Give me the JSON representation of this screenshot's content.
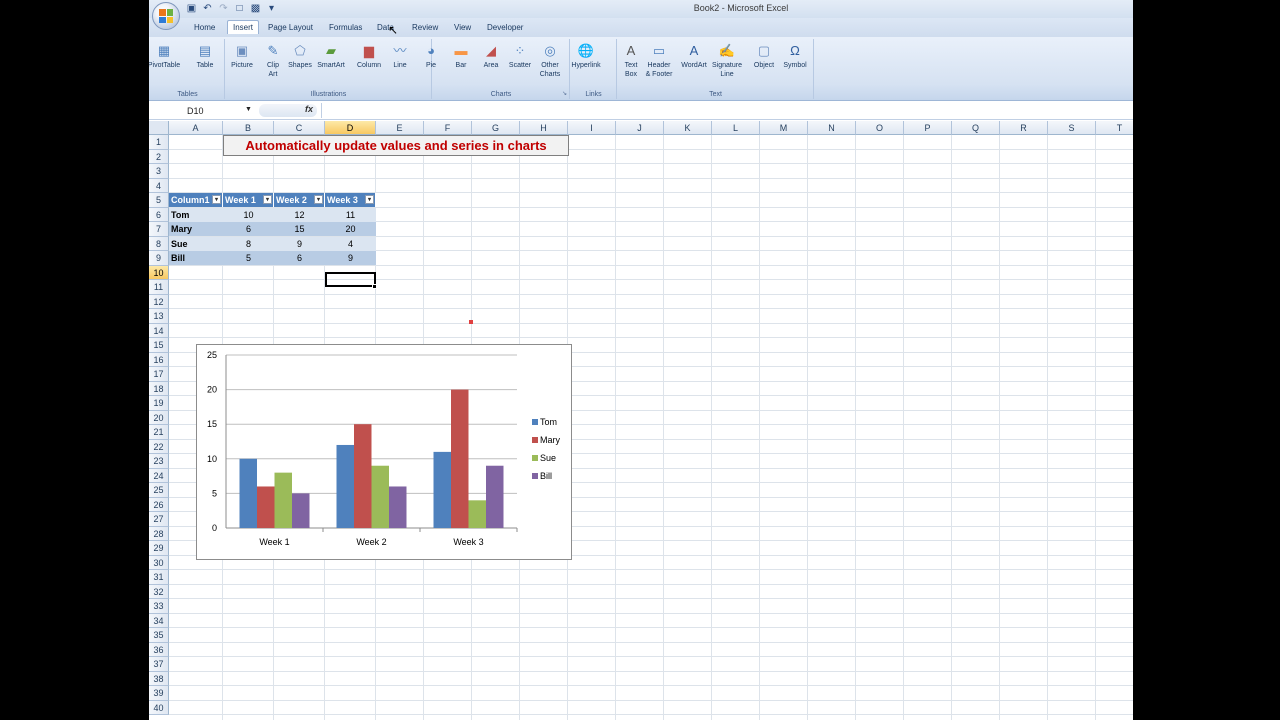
{
  "window": {
    "title": "Book2 - Microsoft Excel"
  },
  "tabs": [
    "Home",
    "Insert",
    "Page Layout",
    "Formulas",
    "Data",
    "Review",
    "View",
    "Developer"
  ],
  "ribbon": {
    "tables": {
      "label": "Tables",
      "items": [
        "PivotTable",
        "Table"
      ]
    },
    "illustrations": {
      "label": "Illustrations",
      "items": [
        "Picture",
        "Clip\nArt",
        "Shapes",
        "SmartArt"
      ]
    },
    "charts": {
      "label": "Charts",
      "items": [
        "Column",
        "Line",
        "Pie",
        "Bar",
        "Area",
        "Scatter",
        "Other\nCharts"
      ]
    },
    "links": {
      "label": "Links",
      "items": [
        "Hyperlink"
      ]
    },
    "text": {
      "label": "Text",
      "items": [
        "Text\nBox",
        "Header\n& Footer",
        "WordArt",
        "Signature\nLine",
        "Object",
        "Symbol"
      ]
    }
  },
  "formula_bar": {
    "name_box": "D10",
    "fx": "fx",
    "value": ""
  },
  "columns": [
    "A",
    "B",
    "C",
    "D",
    "E",
    "F",
    "G",
    "H",
    "I",
    "J",
    "K",
    "L",
    "M",
    "N",
    "O",
    "P",
    "Q",
    "R",
    "S",
    "T"
  ],
  "selected_column": "D",
  "selected_row": 10,
  "rows": 40,
  "sheet": {
    "title": "Automatically update values and series in charts",
    "table_headers": [
      "Column1",
      "Week 1",
      "Week 2",
      "Week 3"
    ],
    "table_rows": [
      {
        "name": "Tom",
        "values": [
          "10",
          "12",
          "11"
        ]
      },
      {
        "name": "Mary",
        "values": [
          "6",
          "15",
          "20"
        ]
      },
      {
        "name": "Sue",
        "values": [
          "8",
          "9",
          "4"
        ]
      },
      {
        "name": "Bill",
        "values": [
          "5",
          "6",
          "9"
        ]
      }
    ]
  },
  "chart_data": {
    "type": "bar",
    "categories": [
      "Week 1",
      "Week 2",
      "Week 3"
    ],
    "series": [
      {
        "name": "Tom",
        "values": [
          10,
          12,
          11
        ],
        "color": "#4f81bd"
      },
      {
        "name": "Mary",
        "values": [
          6,
          15,
          20
        ],
        "color": "#c0504d"
      },
      {
        "name": "Sue",
        "values": [
          8,
          9,
          4
        ],
        "color": "#9bbb59"
      },
      {
        "name": "Bill",
        "values": [
          5,
          6,
          9
        ],
        "color": "#8064a2"
      }
    ],
    "yticks": [
      0,
      5,
      10,
      15,
      20,
      25
    ],
    "ylim": [
      0,
      25
    ],
    "legend": "right",
    "grid": true,
    "title": "",
    "xlabel": "",
    "ylabel": ""
  }
}
